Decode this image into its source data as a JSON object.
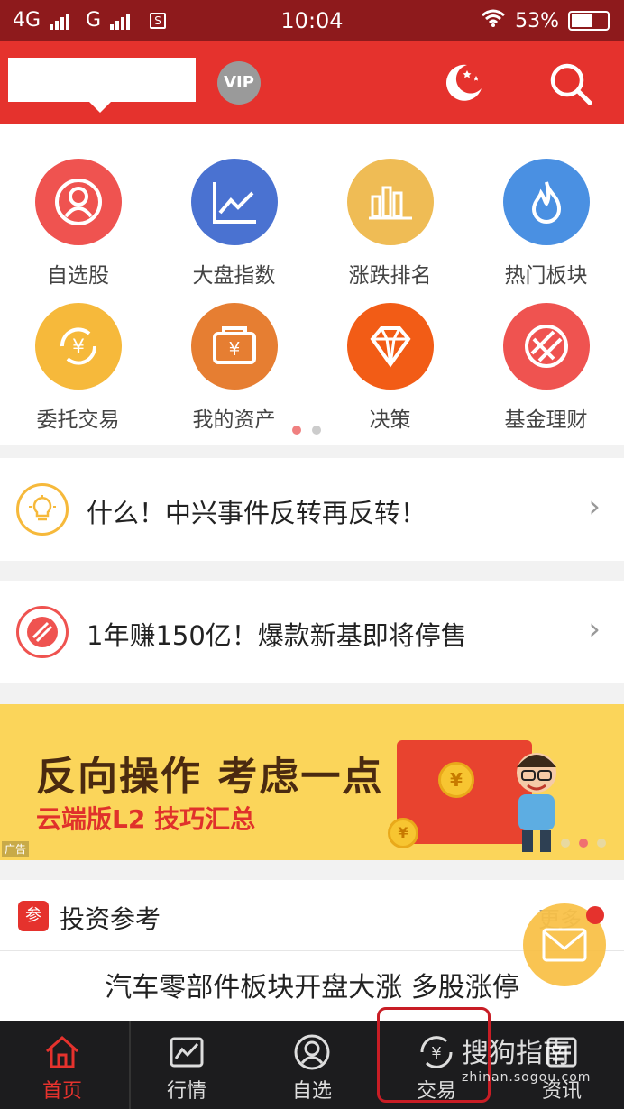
{
  "status": {
    "network1": "4G",
    "network2": "G",
    "time": "10:04",
    "battery": "53%"
  },
  "header": {
    "vip": "VIP"
  },
  "grid": [
    {
      "label": "自选股",
      "icon": "profile-icon",
      "color": "#ef5350"
    },
    {
      "label": "大盘指数",
      "icon": "line-chart-icon",
      "color": "#4a72d1"
    },
    {
      "label": "涨跌排名",
      "icon": "bar-chart-icon",
      "color": "#efbc55"
    },
    {
      "label": "热门板块",
      "icon": "flame-icon",
      "color": "#4a90e2"
    },
    {
      "label": "委托交易",
      "icon": "yuan-cycle-icon",
      "color": "#f6b93b"
    },
    {
      "label": "我的资产",
      "icon": "wallet-icon",
      "color": "#e67e32"
    },
    {
      "label": "决策",
      "icon": "diamond-icon",
      "color": "#f25c16"
    },
    {
      "label": "基金理财",
      "icon": "fund-icon",
      "color": "#ef5350"
    }
  ],
  "news": [
    {
      "text": "什么！中兴事件反转再反转！",
      "icon": "lightbulb-icon"
    },
    {
      "text": "1年赚150亿！爆款新基即将停售",
      "icon": "fund-icon"
    }
  ],
  "banner": {
    "title": "反向操作 考虑一点",
    "subtitle": "云端版L2 技巧汇总",
    "ad": "广告"
  },
  "reference": {
    "badge": "参",
    "title": "投资参考",
    "more": "更多",
    "headline": "汽车零部件板块开盘大涨 多股涨停"
  },
  "tabs": [
    {
      "label": "首页",
      "icon": "home-icon"
    },
    {
      "label": "行情",
      "icon": "market-icon"
    },
    {
      "label": "自选",
      "icon": "profile-icon"
    },
    {
      "label": "交易",
      "icon": "yuan-cycle-icon"
    },
    {
      "label": "资讯",
      "icon": "news-icon"
    }
  ],
  "watermark": {
    "line1": "搜狗指南",
    "line2": "zhinan.sogou.com"
  }
}
